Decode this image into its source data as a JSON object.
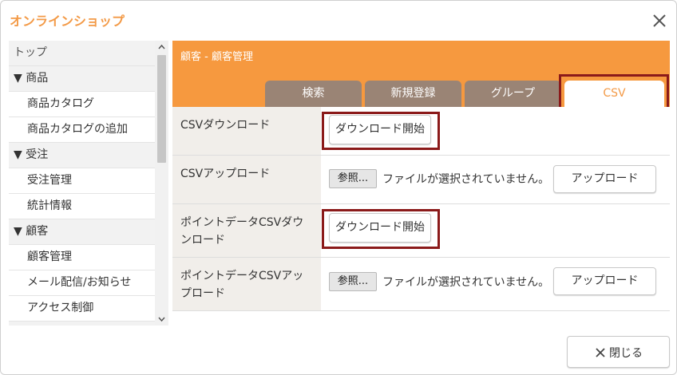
{
  "dialog": {
    "title": "オンラインショップ",
    "close_label": "閉じる"
  },
  "sidebar": {
    "items": [
      {
        "label": "トップ",
        "kind": "top"
      },
      {
        "label": "▼ 商品",
        "kind": "cat"
      },
      {
        "label": "商品カタログ",
        "kind": "sub"
      },
      {
        "label": "商品カタログの追加",
        "kind": "sub"
      },
      {
        "label": "▼ 受注",
        "kind": "cat"
      },
      {
        "label": "受注管理",
        "kind": "sub"
      },
      {
        "label": "統計情報",
        "kind": "sub"
      },
      {
        "label": "▼ 顧客",
        "kind": "cat"
      },
      {
        "label": "顧客管理",
        "kind": "sub"
      },
      {
        "label": "メール配信/お知らせ",
        "kind": "sub"
      },
      {
        "label": "アクセス制御",
        "kind": "sub"
      }
    ]
  },
  "panel": {
    "header": "顧客 - 顧客管理",
    "tabs": [
      {
        "label": "検索"
      },
      {
        "label": "新規登録"
      },
      {
        "label": "グループ"
      },
      {
        "label": "CSV",
        "active": true
      }
    ]
  },
  "rows": [
    {
      "label": "CSVダウンロード",
      "button": "ダウンロード開始"
    },
    {
      "label": "CSVアップロード",
      "browse": "参照...",
      "file_status": "ファイルが選択されていません。",
      "button": "アップロード"
    },
    {
      "label": "ポイントデータCSVダウンロード",
      "button": "ダウンロード開始"
    },
    {
      "label": "ポイントデータCSVアップロード",
      "browse": "参照...",
      "file_status": "ファイルが選択されていません。",
      "button": "アップロード"
    }
  ],
  "colors": {
    "accent": "#f6993f",
    "tab_inactive": "#9a8475",
    "highlight": "#8b1a1a",
    "label_bg": "#f1eeea"
  }
}
